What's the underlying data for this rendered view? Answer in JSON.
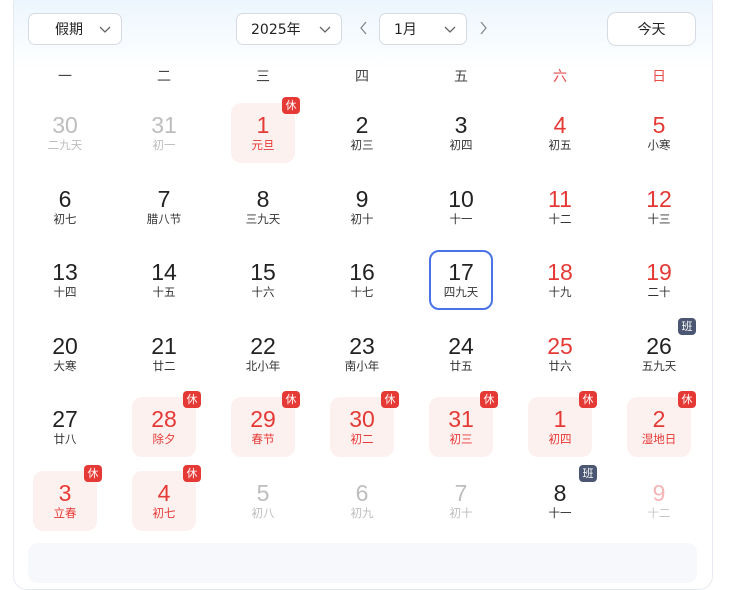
{
  "toolbar": {
    "holiday_select": "假期",
    "year_select": "2025年",
    "month_select": "1月",
    "today_button": "今天"
  },
  "weekdays": [
    "一",
    "二",
    "三",
    "四",
    "五",
    "六",
    "日"
  ],
  "colors": {
    "accent": "#4a73e8",
    "holiday": "#e53935",
    "work_badge": "#4b5672"
  },
  "today": "17",
  "rows": [
    [
      {
        "n": "30",
        "s": "二九天",
        "t": "o"
      },
      {
        "n": "31",
        "s": "初一",
        "t": "o"
      },
      {
        "n": "1",
        "s": "元旦",
        "t": "h",
        "b": "休"
      },
      {
        "n": "2",
        "s": "初三",
        "t": "n"
      },
      {
        "n": "3",
        "s": "初四",
        "t": "n"
      },
      {
        "n": "4",
        "s": "初五",
        "t": "w"
      },
      {
        "n": "5",
        "s": "小寒",
        "t": "w"
      }
    ],
    [
      {
        "n": "6",
        "s": "初七",
        "t": "n"
      },
      {
        "n": "7",
        "s": "腊八节",
        "t": "n"
      },
      {
        "n": "8",
        "s": "三九天",
        "t": "n"
      },
      {
        "n": "9",
        "s": "初十",
        "t": "n"
      },
      {
        "n": "10",
        "s": "十一",
        "t": "n"
      },
      {
        "n": "11",
        "s": "十二",
        "t": "w"
      },
      {
        "n": "12",
        "s": "十三",
        "t": "w"
      }
    ],
    [
      {
        "n": "13",
        "s": "十四",
        "t": "n"
      },
      {
        "n": "14",
        "s": "十五",
        "t": "n"
      },
      {
        "n": "15",
        "s": "十六",
        "t": "n"
      },
      {
        "n": "16",
        "s": "十七",
        "t": "n"
      },
      {
        "n": "17",
        "s": "四九天",
        "t": "n today"
      },
      {
        "n": "18",
        "s": "十九",
        "t": "w"
      },
      {
        "n": "19",
        "s": "二十",
        "t": "w"
      }
    ],
    [
      {
        "n": "20",
        "s": "大寒",
        "t": "n"
      },
      {
        "n": "21",
        "s": "廿二",
        "t": "n"
      },
      {
        "n": "22",
        "s": "北小年",
        "t": "n"
      },
      {
        "n": "23",
        "s": "南小年",
        "t": "n"
      },
      {
        "n": "24",
        "s": "廿五",
        "t": "n"
      },
      {
        "n": "25",
        "s": "廿六",
        "t": "w"
      },
      {
        "n": "26",
        "s": "五九天",
        "t": "n",
        "b": "班"
      }
    ],
    [
      {
        "n": "27",
        "s": "廿八",
        "t": "n"
      },
      {
        "n": "28",
        "s": "除夕",
        "t": "h",
        "b": "休"
      },
      {
        "n": "29",
        "s": "春节",
        "t": "h",
        "b": "休"
      },
      {
        "n": "30",
        "s": "初二",
        "t": "h",
        "b": "休"
      },
      {
        "n": "31",
        "s": "初三",
        "t": "h",
        "b": "休"
      },
      {
        "n": "1",
        "s": "初四",
        "t": "h",
        "b": "休"
      },
      {
        "n": "2",
        "s": "湿地日",
        "t": "h",
        "b": "休"
      }
    ],
    [
      {
        "n": "3",
        "s": "立春",
        "t": "h",
        "b": "休"
      },
      {
        "n": "4",
        "s": "初七",
        "t": "h",
        "b": "休"
      },
      {
        "n": "5",
        "s": "初八",
        "t": "o"
      },
      {
        "n": "6",
        "s": "初九",
        "t": "o"
      },
      {
        "n": "7",
        "s": "初十",
        "t": "o"
      },
      {
        "n": "8",
        "s": "十一",
        "t": "n",
        "b": "班"
      },
      {
        "n": "9",
        "s": "十二",
        "t": "f"
      }
    ]
  ]
}
